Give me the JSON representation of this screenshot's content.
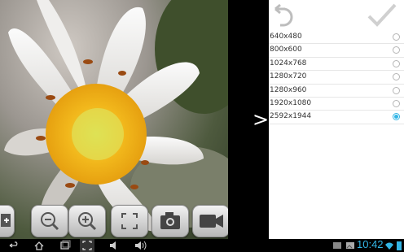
{
  "resolutions": [
    {
      "label": "640x480",
      "selected": false
    },
    {
      "label": "800x600",
      "selected": false
    },
    {
      "label": "1024x768",
      "selected": false
    },
    {
      "label": "1280x720",
      "selected": false
    },
    {
      "label": "1280x960",
      "selected": false
    },
    {
      "label": "1920x1080",
      "selected": false
    },
    {
      "label": "2592x1944",
      "selected": true
    }
  ],
  "status": {
    "time": "10:42"
  },
  "colors": {
    "accent": "#33b5e5"
  }
}
